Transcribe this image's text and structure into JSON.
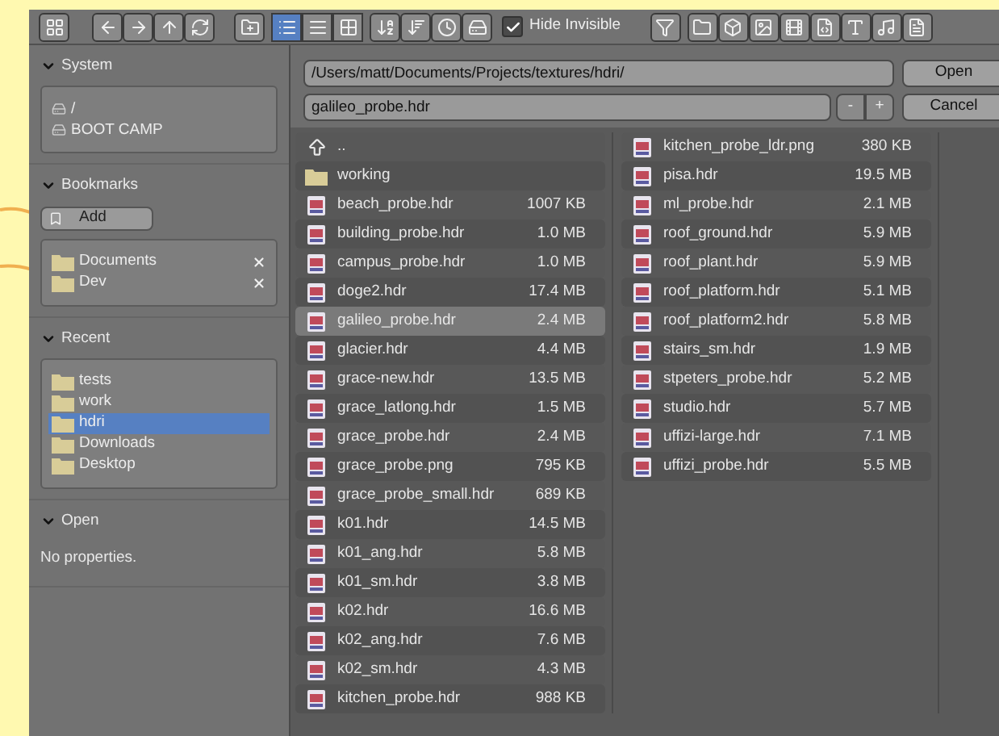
{
  "toolbar": {
    "display_modes": [
      {
        "selected": true
      },
      {
        "selected": false
      },
      {
        "selected": false
      }
    ],
    "hide_invisible": {
      "label": "Hide Invisible",
      "checked": true
    }
  },
  "sidebar": {
    "sections": [
      {
        "title": "System",
        "expanded": true,
        "items": [
          {
            "label": "/",
            "selected": false
          },
          {
            "label": "BOOT CAMP",
            "selected": false
          }
        ]
      },
      {
        "title": "Bookmarks",
        "expanded": true,
        "add_button": "Add",
        "items": [
          {
            "label": "Documents",
            "selected": false
          },
          {
            "label": "Dev",
            "selected": false
          }
        ]
      },
      {
        "title": "Recent",
        "expanded": true,
        "items": [
          {
            "label": "tests",
            "selected": false
          },
          {
            "label": "work",
            "selected": false
          },
          {
            "label": "hdri",
            "selected": true
          },
          {
            "label": "Downloads",
            "selected": false
          },
          {
            "label": "Desktop",
            "selected": false
          }
        ]
      },
      {
        "title": "Open",
        "expanded": true,
        "note": "No properties."
      }
    ]
  },
  "path": {
    "value": "/Users/matt/Documents/Projects/textures/hdri/"
  },
  "filename": {
    "value": "galileo_probe.hdr",
    "decrement": "-",
    "increment": "+"
  },
  "buttons": {
    "open": "Open",
    "cancel": "Cancel"
  },
  "files": [
    {
      "kind": "parent",
      "name": "..",
      "selected": false
    },
    {
      "kind": "folder",
      "name": "working",
      "selected": false
    },
    {
      "kind": "image",
      "name": "beach_probe.hdr",
      "size": "1007 KB",
      "selected": false
    },
    {
      "kind": "image",
      "name": "building_probe.hdr",
      "size": "1.0 MB",
      "selected": false
    },
    {
      "kind": "image",
      "name": "campus_probe.hdr",
      "size": "1.0 MB",
      "selected": false
    },
    {
      "kind": "image",
      "name": "doge2.hdr",
      "size": "17.4 MB",
      "selected": false
    },
    {
      "kind": "image",
      "name": "galileo_probe.hdr",
      "size": "2.4 MB",
      "selected": true
    },
    {
      "kind": "image",
      "name": "glacier.hdr",
      "size": "4.4 MB",
      "selected": false
    },
    {
      "kind": "image",
      "name": "grace-new.hdr",
      "size": "13.5 MB",
      "selected": false
    },
    {
      "kind": "image",
      "name": "grace_latlong.hdr",
      "size": "1.5 MB",
      "selected": false
    },
    {
      "kind": "image",
      "name": "grace_probe.hdr",
      "size": "2.4 MB",
      "selected": false
    },
    {
      "kind": "image",
      "name": "grace_probe.png",
      "size": "795 KB",
      "selected": false
    },
    {
      "kind": "image",
      "name": "grace_probe_small.hdr",
      "size": "689 KB",
      "selected": false
    },
    {
      "kind": "image",
      "name": "k01.hdr",
      "size": "14.5 MB",
      "selected": false
    },
    {
      "kind": "image",
      "name": "k01_ang.hdr",
      "size": "5.8 MB",
      "selected": false
    },
    {
      "kind": "image",
      "name": "k01_sm.hdr",
      "size": "3.8 MB",
      "selected": false
    },
    {
      "kind": "image",
      "name": "k02.hdr",
      "size": "16.6 MB",
      "selected": false
    },
    {
      "kind": "image",
      "name": "k02_ang.hdr",
      "size": "7.6 MB",
      "selected": false
    },
    {
      "kind": "image",
      "name": "k02_sm.hdr",
      "size": "4.3 MB",
      "selected": false
    },
    {
      "kind": "image",
      "name": "kitchen_probe.hdr",
      "size": "988 KB",
      "selected": false
    },
    {
      "kind": "image",
      "name": "kitchen_probe_ldr.png",
      "size": "380 KB",
      "selected": false
    },
    {
      "kind": "image",
      "name": "pisa.hdr",
      "size": "19.5 MB",
      "selected": false
    },
    {
      "kind": "image",
      "name": "ml_probe.hdr",
      "size": "2.1 MB",
      "selected": false
    },
    {
      "kind": "image",
      "name": "roof_ground.hdr",
      "size": "5.9 MB",
      "selected": false
    },
    {
      "kind": "image",
      "name": "roof_plant.hdr",
      "size": "5.9 MB",
      "selected": false
    },
    {
      "kind": "image",
      "name": "roof_platform.hdr",
      "size": "5.1 MB",
      "selected": false
    },
    {
      "kind": "image",
      "name": "roof_platform2.hdr",
      "size": "5.8 MB",
      "selected": false
    },
    {
      "kind": "image",
      "name": "stairs_sm.hdr",
      "size": "1.9 MB",
      "selected": false
    },
    {
      "kind": "image",
      "name": "stpeters_probe.hdr",
      "size": "5.2 MB",
      "selected": false
    },
    {
      "kind": "image",
      "name": "studio.hdr",
      "size": "5.7 MB",
      "selected": false
    },
    {
      "kind": "image",
      "name": "uffizi-large.hdr",
      "size": "7.1 MB",
      "selected": false
    },
    {
      "kind": "image",
      "name": "uffizi_probe.hdr",
      "size": "5.5 MB",
      "selected": false
    }
  ]
}
